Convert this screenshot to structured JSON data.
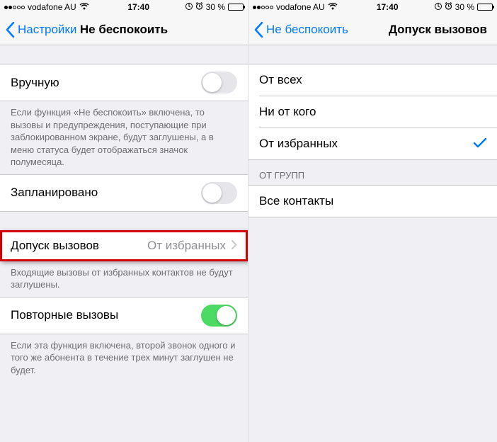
{
  "left": {
    "status": {
      "carrier": "vodafone AU",
      "time": "17:40",
      "battery": "30 %"
    },
    "nav": {
      "back": "Настройки",
      "title": "Не беспокоить"
    },
    "rows": {
      "manual": "Вручную",
      "manual_footer": "Если функция «Не беспокоить» включена, то вызовы и предупреждения, поступающие при заблокированном экране, будут заглушены, а в меню статуса будет отображаться значок полумесяца.",
      "scheduled": "Запланировано",
      "allow_label": "Допуск вызовов",
      "allow_value": "От избранных",
      "allow_footer": "Входящие вызовы от избранных контактов не будут заглушены.",
      "repeat": "Повторные вызовы",
      "repeat_footer": "Если эта функция включена, второй звонок одного и того же абонента в течение трех минут заглушен не будет."
    }
  },
  "right": {
    "status": {
      "carrier": "vodafone AU",
      "time": "17:40",
      "battery": "30 %"
    },
    "nav": {
      "back": "Не беспокоить",
      "title": "Допуск вызовов"
    },
    "options": {
      "everyone": "От всех",
      "noone": "Ни от кого",
      "favorites": "От избранных"
    },
    "groups_header": "ОТ ГРУПП",
    "groups": {
      "all_contacts": "Все контакты"
    }
  }
}
